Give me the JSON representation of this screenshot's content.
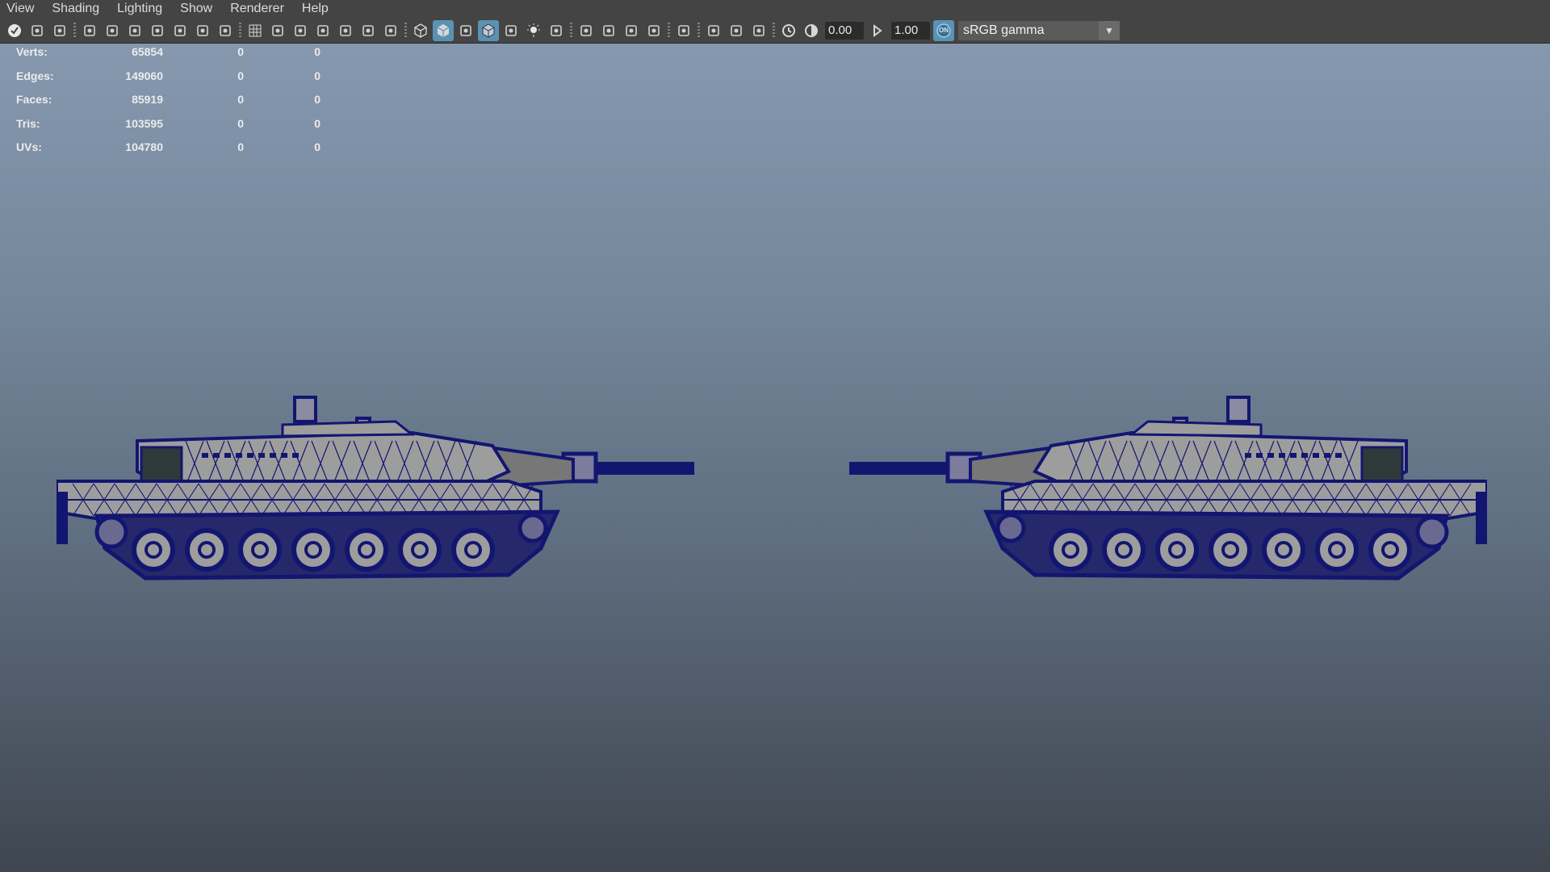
{
  "menubar": {
    "items": [
      "View",
      "Shading",
      "Lighting",
      "Show",
      "Renderer",
      "Help"
    ]
  },
  "toolbar": {
    "icons": [
      "select-camera-icon",
      "camera-attributes-icon",
      "bookmark-icon",
      "sep",
      "film-gate-icon",
      "image-plane-icon",
      "camera-lock-icon",
      "bookmark-2-icon",
      "grease-pencil-icon",
      "2d-pan-icon",
      "paint-icon",
      "sep",
      "grid-icon",
      "film-gate-mask-icon",
      "resolution-gate-icon",
      "gate-mask-icon",
      "field-chart-icon",
      "safe-action-icon",
      "safe-title-icon",
      "sep",
      "wireframe-icon",
      "smooth-shade-icon",
      "default-material-icon",
      "wireframe-on-shaded-icon",
      "textured-icon",
      "use-all-lights-icon",
      "shadows-icon",
      "sep",
      "screen-space-ao-icon",
      "motion-blur-icon",
      "anti-aliasing-icon",
      "depth-of-field-icon",
      "sep",
      "isolate-select-icon",
      "sep",
      "xray-icon",
      "xray-active-components-icon",
      "xray-joints-icon",
      "sep",
      "exposure-icon"
    ],
    "active_icons": [
      "smooth-shade-icon",
      "wireframe-on-shaded-icon"
    ],
    "exposure_value": "0.00",
    "gamma_value": "1.00",
    "color_management_badge": "ON",
    "view_transform": "sRGB gamma"
  },
  "hud": {
    "rows": [
      {
        "label": "Verts:",
        "v1": "65854",
        "v2": "0",
        "v3": "0"
      },
      {
        "label": "Edges:",
        "v1": "149060",
        "v2": "0",
        "v3": "0"
      },
      {
        "label": "Faces:",
        "v1": "85919",
        "v2": "0",
        "v3": "0"
      },
      {
        "label": "Tris:",
        "v1": "103595",
        "v2": "0",
        "v3": "0"
      },
      {
        "label": "UVs:",
        "v1": "104780",
        "v2": "0",
        "v3": "0"
      }
    ]
  },
  "colors": {
    "wireframe": "#131670",
    "hull": "#9d9d9d",
    "accent": "#5a92b4"
  }
}
